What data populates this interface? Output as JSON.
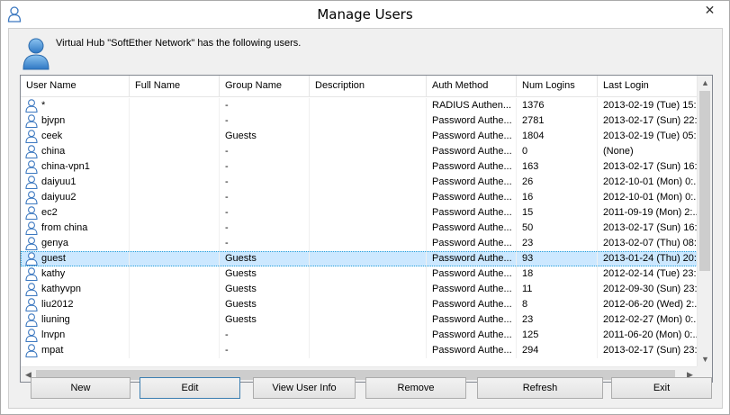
{
  "window": {
    "title": "Manage Users",
    "close_symbol": "✕",
    "title_icon": "user-icon"
  },
  "header": {
    "message": "Virtual Hub \"SoftEther Network\" has the following users.",
    "icon": "user-large-icon"
  },
  "table": {
    "columns": [
      "User Name",
      "Full Name",
      "Group Name",
      "Description",
      "Auth Method",
      "Num Logins",
      "Last Login"
    ],
    "rows": [
      {
        "user": "*",
        "full": "",
        "group": "-",
        "desc": "",
        "auth": "RADIUS Authen...",
        "logins": "1376",
        "last": "2013-02-19 (Tue) 15:..."
      },
      {
        "user": "bjvpn",
        "full": "",
        "group": "-",
        "desc": "",
        "auth": "Password Authe...",
        "logins": "2781",
        "last": "2013-02-17 (Sun) 22:..."
      },
      {
        "user": "ceek",
        "full": "",
        "group": "Guests",
        "desc": "",
        "auth": "Password Authe...",
        "logins": "1804",
        "last": "2013-02-19 (Tue) 05:..."
      },
      {
        "user": "china",
        "full": "",
        "group": "-",
        "desc": "",
        "auth": "Password Authe...",
        "logins": "0",
        "last": "(None)"
      },
      {
        "user": "china-vpn1",
        "full": "",
        "group": "-",
        "desc": "",
        "auth": "Password Authe...",
        "logins": "163",
        "last": "2013-02-17 (Sun) 16:..."
      },
      {
        "user": "daiyuu1",
        "full": "",
        "group": "-",
        "desc": "",
        "auth": "Password Authe...",
        "logins": "26",
        "last": "2012-10-01 (Mon) 0:..."
      },
      {
        "user": "daiyuu2",
        "full": "",
        "group": "-",
        "desc": "",
        "auth": "Password Authe...",
        "logins": "16",
        "last": "2012-10-01 (Mon) 0:..."
      },
      {
        "user": "ec2",
        "full": "",
        "group": "-",
        "desc": "",
        "auth": "Password Authe...",
        "logins": "15",
        "last": "2011-09-19 (Mon) 2:..."
      },
      {
        "user": "from china",
        "full": "",
        "group": "-",
        "desc": "",
        "auth": "Password Authe...",
        "logins": "50",
        "last": "2013-02-17 (Sun) 16:..."
      },
      {
        "user": "genya",
        "full": "",
        "group": "-",
        "desc": "",
        "auth": "Password Authe...",
        "logins": "23",
        "last": "2013-02-07 (Thu) 08:..."
      },
      {
        "user": "guest",
        "full": "",
        "group": "Guests",
        "desc": "",
        "auth": "Password Authe...",
        "logins": "93",
        "last": "2013-01-24 (Thu) 20:..."
      },
      {
        "user": "kathy",
        "full": "",
        "group": "Guests",
        "desc": "",
        "auth": "Password Authe...",
        "logins": "18",
        "last": "2012-02-14 (Tue) 23:..."
      },
      {
        "user": "kathyvpn",
        "full": "",
        "group": "Guests",
        "desc": "",
        "auth": "Password Authe...",
        "logins": "11",
        "last": "2012-09-30 (Sun) 23:..."
      },
      {
        "user": "liu2012",
        "full": "",
        "group": "Guests",
        "desc": "",
        "auth": "Password Authe...",
        "logins": "8",
        "last": "2012-06-20 (Wed) 2:..."
      },
      {
        "user": "liuning",
        "full": "",
        "group": "Guests",
        "desc": "",
        "auth": "Password Authe...",
        "logins": "23",
        "last": "2012-02-27 (Mon) 0:..."
      },
      {
        "user": "lnvpn",
        "full": "",
        "group": "-",
        "desc": "",
        "auth": "Password Authe...",
        "logins": "125",
        "last": "2011-06-20 (Mon) 0:..."
      },
      {
        "user": "mpat",
        "full": "",
        "group": "-",
        "desc": "",
        "auth": "Password Authe...",
        "logins": "294",
        "last": "2013-02-17 (Sun) 23:..."
      }
    ],
    "selected_index": 10
  },
  "buttons": {
    "new": "New",
    "edit": "Edit",
    "view_user_info": "View User Info",
    "remove": "Remove",
    "refresh": "Refresh",
    "exit": "Exit"
  },
  "scrollbar": {
    "up": "▲",
    "down": "▼",
    "left": "◀",
    "right": "▶"
  },
  "colors": {
    "selection": "#cce8ff",
    "icon_blue": "#4a90d9"
  }
}
